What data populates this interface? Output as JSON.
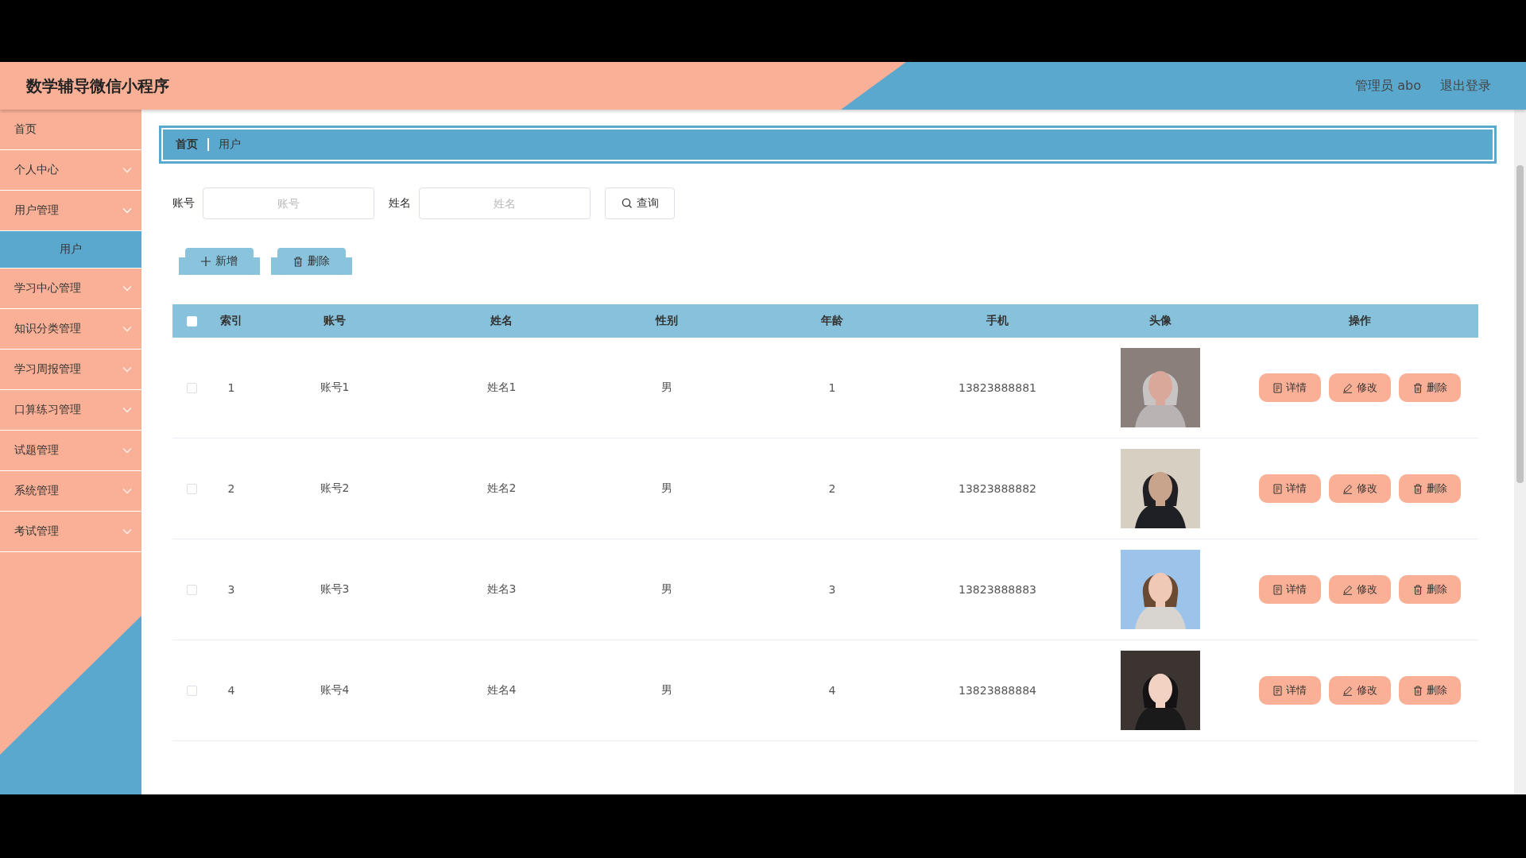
{
  "header": {
    "title": "数学辅导微信小程序",
    "user": "管理员 abo",
    "logout": "退出登录"
  },
  "sidebar": {
    "items": [
      {
        "label": "首页",
        "kind": "link",
        "selected": false
      },
      {
        "label": "个人中心",
        "kind": "submenu",
        "expanded": false
      },
      {
        "label": "用户管理",
        "kind": "submenu",
        "expanded": true,
        "children": [
          {
            "label": "用户",
            "selected": true
          }
        ]
      },
      {
        "label": "学习中心管理",
        "kind": "submenu",
        "expanded": false
      },
      {
        "label": "知识分类管理",
        "kind": "submenu",
        "expanded": false
      },
      {
        "label": "学习周报管理",
        "kind": "submenu",
        "expanded": false
      },
      {
        "label": "口算练习管理",
        "kind": "submenu",
        "expanded": false
      },
      {
        "label": "试题管理",
        "kind": "submenu",
        "expanded": false
      },
      {
        "label": "系统管理",
        "kind": "submenu",
        "expanded": false
      },
      {
        "label": "考试管理",
        "kind": "submenu",
        "expanded": false
      }
    ]
  },
  "breadcrumb": [
    "首页",
    "用户"
  ],
  "search": {
    "fields": [
      {
        "label": "账号",
        "placeholder": "账号"
      },
      {
        "label": "姓名",
        "placeholder": "姓名"
      }
    ],
    "button": "查询"
  },
  "toolbar": [
    {
      "kind": "add",
      "label": "新增"
    },
    {
      "kind": "delete",
      "label": "删除"
    }
  ],
  "table": {
    "select_all": {
      "checked": false
    },
    "columns": [
      "索引",
      "账号",
      "姓名",
      "性别",
      "年龄",
      "手机",
      "头像",
      "操作"
    ],
    "rows": [
      {
        "checked": false,
        "index": "1",
        "account": "账号1",
        "name": "姓名1",
        "gender": "男",
        "age": "1",
        "phone": "13823888881",
        "avatar": {
          "kind": "picture"
        },
        "actions": [
          {
            "kind": "detail",
            "label": "详情"
          },
          {
            "kind": "edit",
            "label": "修改"
          },
          {
            "kind": "delete",
            "label": "删除"
          }
        ]
      },
      {
        "checked": false,
        "index": "2",
        "account": "账号2",
        "name": "姓名2",
        "gender": "男",
        "age": "2",
        "phone": "13823888882",
        "avatar": {
          "kind": "picture"
        },
        "actions": [
          {
            "kind": "detail",
            "label": "详情"
          },
          {
            "kind": "edit",
            "label": "修改"
          },
          {
            "kind": "delete",
            "label": "删除"
          }
        ]
      },
      {
        "checked": false,
        "index": "3",
        "account": "账号3",
        "name": "姓名3",
        "gender": "男",
        "age": "3",
        "phone": "13823888883",
        "avatar": {
          "kind": "picture"
        },
        "actions": [
          {
            "kind": "detail",
            "label": "详情"
          },
          {
            "kind": "edit",
            "label": "修改"
          },
          {
            "kind": "delete",
            "label": "删除"
          }
        ]
      },
      {
        "checked": false,
        "index": "4",
        "account": "账号4",
        "name": "姓名4",
        "gender": "男",
        "age": "4",
        "phone": "13823888884",
        "avatar": {
          "kind": "picture"
        },
        "actions": [
          {
            "kind": "detail",
            "label": "详情"
          },
          {
            "kind": "edit",
            "label": "修改"
          },
          {
            "kind": "delete",
            "label": "删除"
          }
        ]
      }
    ]
  }
}
